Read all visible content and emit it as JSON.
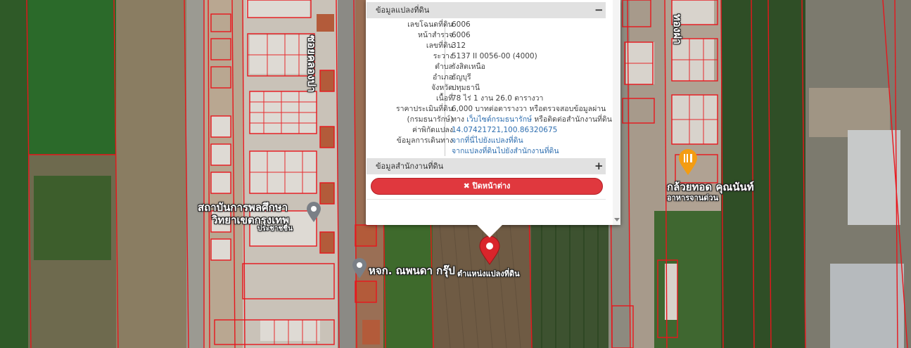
{
  "popup": {
    "section_parcel_title": "ข้อมูลแปลงที่ดิน",
    "section_parcel_toggle": "−",
    "section_office_title": "ข้อมูลสำนักงานที่ดิน",
    "section_office_toggle": "+",
    "fields": {
      "deed_no": {
        "label": "เลขโฉนดที่ดิน",
        "value": "6006"
      },
      "survey_page": {
        "label": "หน้าสำรวจ",
        "value": "6006"
      },
      "land_no": {
        "label": "เลขที่ดิน",
        "value": "312"
      },
      "map_sheet": {
        "label": "ระวาง",
        "value": "5137 II 0056-00 (4000)"
      },
      "subdistrict": {
        "label": "ตำบล",
        "value": "รังสิตเหนือ"
      },
      "district": {
        "label": "อำเภอ",
        "value": "ธัญบุรี"
      },
      "province": {
        "label": "จังหวัด",
        "value": "ปทุมธานี"
      },
      "area": {
        "label": "เนื้อที่",
        "value": "78 ไร่ 1 งาน 26.0 ตารางวา"
      },
      "appraisal": {
        "label1": "ราคาประเมินที่ดิน",
        "label2": "(กรมธนารักษ์)",
        "value1": "6,000 บาทต่อตารางวา หรือตรวจสอบข้อมูลผ่าน",
        "value2_prefix": "ทาง",
        "value2_link": "เว็บไซต์กรมธนารักษ์",
        "value2_suffix": "หรือติดต่อสำนักงานที่ดิน"
      },
      "coords": {
        "label": "ค่าพิกัดแปลง",
        "value": "14.07421721,100.86320675"
      },
      "route": {
        "label": "ข้อมูลการเดินทาง",
        "link1": "จากที่นี่ไปยังแปลงที่ดิน",
        "link2": "จากแปลงที่ดินไปยังสำนักงานที่ดิน"
      }
    },
    "close_icon": "✖",
    "close_label": "ปิดหน้าต่าง"
  },
  "map": {
    "labels": {
      "road_left": "ซอยคลองปา",
      "road_right": "ทองฝา",
      "school1": "สถาบันการพลศึกษา",
      "school2": "วิทยาเขตกรุงเทพ",
      "school3": "ประชาชชื่น",
      "company": "หจก. ณพนดา กรุ๊ป",
      "parcel_marker": "ตำแหน่งแปลงที่ดิน",
      "restaurant": "กล้วยทอด คุณนันท์",
      "restaurant_sub": "อาหารจานด่วน"
    },
    "colors": {
      "parcel_line": "#e8161c",
      "marker_red": "#d9252b",
      "marker_orange": "#f39c12",
      "marker_gray": "#7a7f86"
    }
  }
}
